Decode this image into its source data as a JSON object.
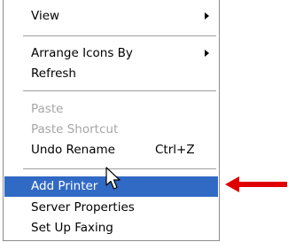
{
  "menu": {
    "items": [
      {
        "label": "View",
        "submenu": true
      },
      {
        "label": "Arrange Icons By",
        "submenu": true
      },
      {
        "label": "Refresh"
      },
      {
        "label": "Paste",
        "disabled": true
      },
      {
        "label": "Paste Shortcut",
        "disabled": true
      },
      {
        "label": "Undo Rename",
        "shortcut": "Ctrl+Z"
      },
      {
        "label": "Add Printer",
        "highlighted": true
      },
      {
        "label": "Server Properties"
      },
      {
        "label": "Set Up Faxing"
      }
    ]
  },
  "colors": {
    "highlight": "#316ac5",
    "disabled_text": "#a6a6a6",
    "arrow": "#e10000"
  },
  "icons": [
    "submenu-arrow-icon",
    "mouse-pointer-icon",
    "red-arrow-icon"
  ]
}
